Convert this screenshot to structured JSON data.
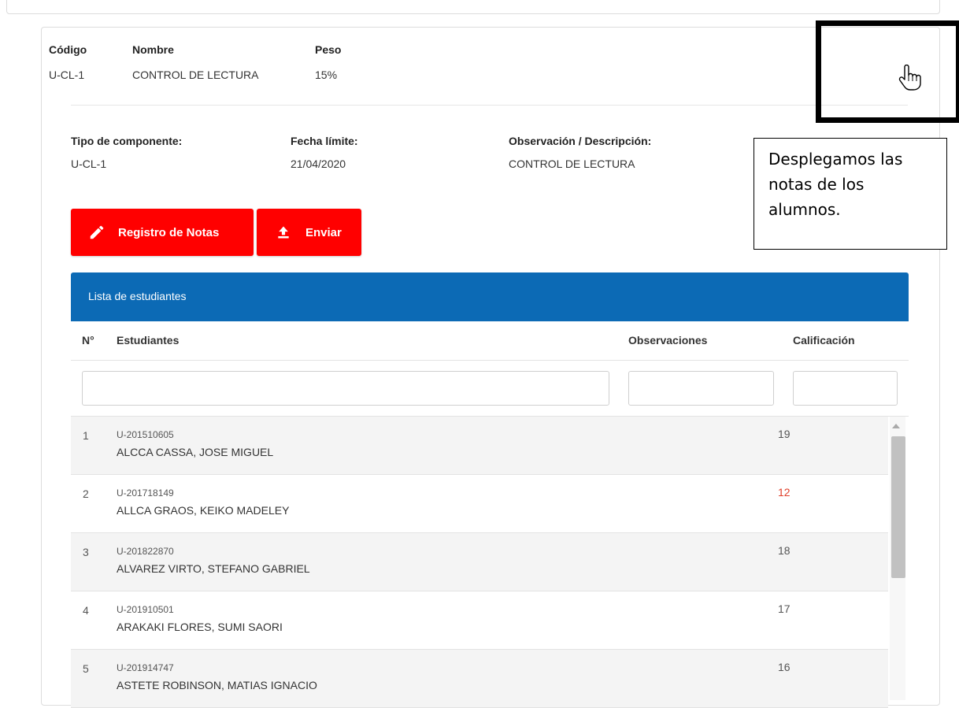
{
  "component": {
    "codigo_label": "Código",
    "codigo_value": "U-CL-1",
    "nombre_label": "Nombre",
    "nombre_value": "CONTROL DE LECTURA",
    "peso_label": "Peso",
    "peso_value": "15%"
  },
  "details": {
    "tipo_label": "Tipo de componente:",
    "tipo_value": "U-CL-1",
    "fecha_label": "Fecha límite:",
    "fecha_value": "21/04/2020",
    "obs_label": "Observación / Descripción:",
    "obs_value": "CONTROL DE LECTURA"
  },
  "actions": {
    "registro_label": "Registro de Notas",
    "registro_icon": "pencil-icon",
    "enviar_label": "Enviar",
    "enviar_icon": "upload-icon",
    "button_color": "#ff0000"
  },
  "table": {
    "title": "Lista de estudiantes",
    "header_color": "#0c6ab5",
    "columns": {
      "num": "N°",
      "students": "Estudiantes",
      "observaciones": "Observaciones",
      "calificacion": "Calificación"
    },
    "rows": [
      {
        "num": "1",
        "code": "U-201510605",
        "name": "ALCCA CASSA, JOSE MIGUEL",
        "grade": "19"
      },
      {
        "num": "2",
        "code": "U-201718149",
        "name": "ALLCA GRAOS, KEIKO MADELEY",
        "grade": "12"
      },
      {
        "num": "3",
        "code": "U-201822870",
        "name": "ALVAREZ VIRTO, STEFANO GABRIEL",
        "grade": "18"
      },
      {
        "num": "4",
        "code": "U-201910501",
        "name": "ARAKAKI FLORES, SUMI SAORI",
        "grade": "17"
      },
      {
        "num": "5",
        "code": "U-201914747",
        "name": "ASTETE ROBINSON, MATIAS IGNACIO",
        "grade": "16"
      }
    ]
  },
  "annotation": {
    "callout_text": "Desplegamos las notas de los alumnos.",
    "cursor_icon": "hand-pointer-icon"
  }
}
